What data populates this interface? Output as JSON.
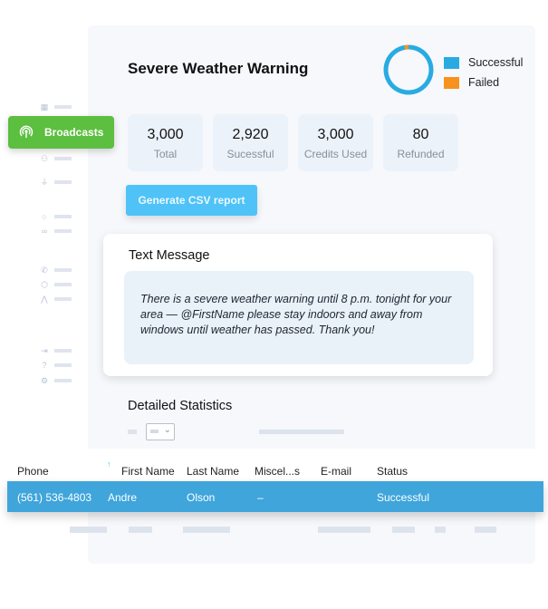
{
  "header": {
    "title": "Severe Weather Warning"
  },
  "chart_data": {
    "type": "pie",
    "title": "",
    "categories": [
      "Successful",
      "Failed"
    ],
    "values": [
      2920,
      80
    ],
    "colors": [
      "#29abe2",
      "#f7921e"
    ],
    "legend_position": "right"
  },
  "legend": [
    {
      "label": "Successful",
      "color": "#29abe2"
    },
    {
      "label": "Failed",
      "color": "#f7921e"
    }
  ],
  "stats": [
    {
      "value": "3,000",
      "label": "Total"
    },
    {
      "value": "2,920",
      "label": "Sucessful"
    },
    {
      "value": "3,000",
      "label": "Credits Used"
    },
    {
      "value": "80",
      "label": "Refunded"
    }
  ],
  "csv_button": "Generate CSV report",
  "message": {
    "heading": "Text Message",
    "body": "There is a severe weather warning until 8 p.m. tonight for your area — @FirstName please stay indoors and away from windows until weather has passed. Thank you!"
  },
  "detailed": {
    "heading": "Detailed Statistics"
  },
  "table": {
    "columns": [
      "Phone",
      "First Name",
      "Last Name",
      "Miscel...s",
      "E-mail",
      "Status"
    ],
    "rows": [
      {
        "phone": "(561) 536-4803",
        "first": "Andre",
        "last": "Olson",
        "misc": "–",
        "email": "",
        "status": "Successful"
      }
    ]
  },
  "sidebar": {
    "active": {
      "label": "Broadcasts",
      "icon": "broadcast-icon"
    },
    "icons": [
      "dashboard-icon",
      "contacts-icon",
      "microphone-icon",
      "chat-icon",
      "voicemail-icon",
      "phone-icon",
      "package-icon",
      "network-icon",
      "logout-icon",
      "help-icon",
      "settings-icon"
    ]
  }
}
